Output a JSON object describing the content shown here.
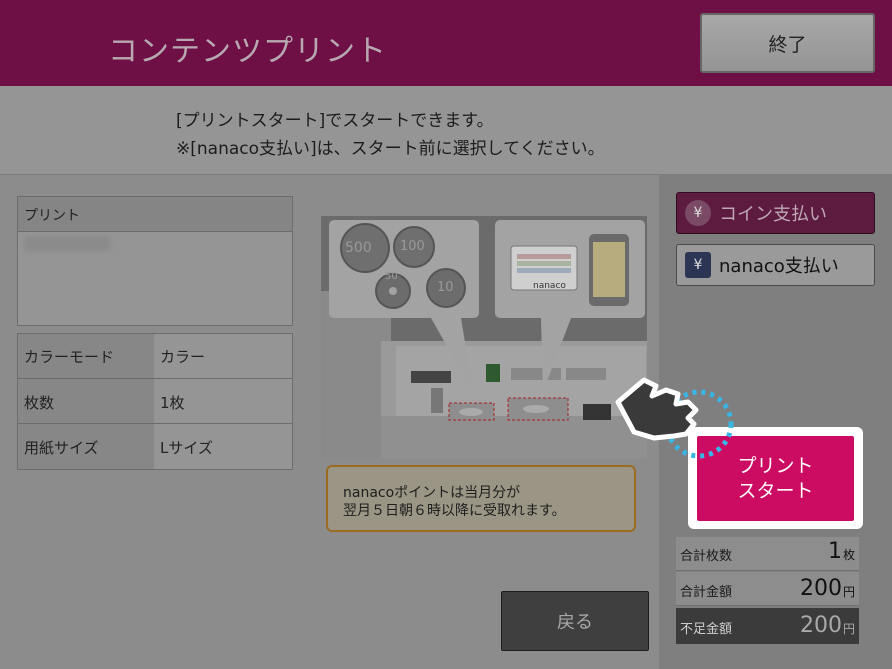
{
  "header": {
    "title": "コンテンツプリント",
    "end_label": "終了"
  },
  "message": {
    "line1": "[プリントスタート]でスタートできます。",
    "line2": "※[nanaco支払い]は、スタート前に選択してください。"
  },
  "print_box": {
    "label": "プリント"
  },
  "settings": {
    "rows": [
      {
        "label": "カラーモード",
        "value": "カラー"
      },
      {
        "label": "枚数",
        "value": "1枚"
      },
      {
        "label": "用紙サイズ",
        "value": "Lサイズ"
      }
    ]
  },
  "illustration": {
    "coins": [
      "500",
      "100",
      "50",
      "10"
    ],
    "card_label": "nanaco"
  },
  "notice": {
    "line1": "nanacoポイントは当月分が",
    "line2": "翌月５日朝６時以降に受取れます。",
    "border_color": "#9c6b22"
  },
  "back_label": "戻る",
  "payment": {
    "coin": {
      "icon": "yen-icon",
      "label": "コイン支払い"
    },
    "nanaco": {
      "icon": "yen-icon",
      "label": "nanaco支払い"
    }
  },
  "start_button": {
    "line1": "プリント",
    "line2": "スタート",
    "color": "#cc0c63"
  },
  "totals": {
    "count": {
      "label": "合計枚数",
      "value": "1",
      "unit": "枚"
    },
    "total": {
      "label": "合計金額",
      "value": "200",
      "unit": "円"
    },
    "shortage": {
      "label": "不足金額",
      "value": "200",
      "unit": "円"
    }
  },
  "colors": {
    "header": "#6e0f45",
    "accent": "#cc0c63"
  }
}
